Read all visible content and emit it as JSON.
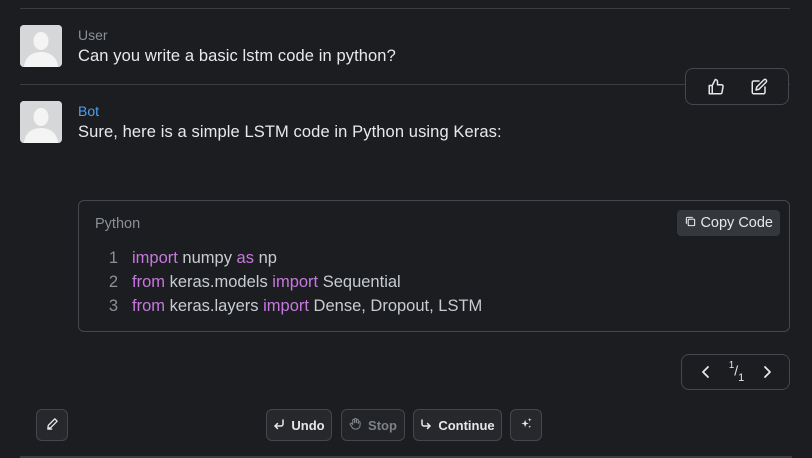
{
  "messages": [
    {
      "author": "User",
      "text": "Can you write a basic lstm code in python?"
    },
    {
      "author": "Bot",
      "text": "Sure, here is a simple LSTM code in Python using Keras:"
    }
  ],
  "code_block": {
    "language": "Python",
    "copy_label": "Copy Code",
    "lines": [
      {
        "num": "1",
        "tokens": [
          [
            "kw",
            "import"
          ],
          [
            "tx",
            " numpy "
          ],
          [
            "kw",
            "as"
          ],
          [
            "tx",
            " np"
          ]
        ]
      },
      {
        "num": "2",
        "tokens": [
          [
            "kw",
            "from"
          ],
          [
            "tx",
            " keras.models "
          ],
          [
            "kw",
            "import"
          ],
          [
            "tx",
            " Sequential"
          ]
        ]
      },
      {
        "num": "3",
        "tokens": [
          [
            "kw",
            "from"
          ],
          [
            "tx",
            " keras.layers "
          ],
          [
            "kw",
            "import"
          ],
          [
            "tx",
            " Dense, Dropout, LSTM"
          ]
        ]
      }
    ]
  },
  "pager": {
    "current": "1",
    "total": "1"
  },
  "toolbar": {
    "undo_label": "Undo",
    "stop_label": "Stop",
    "continue_label": "Continue"
  },
  "colors": {
    "background": "#1b1d20",
    "keyword": "#c678dd",
    "bot_author": "#4ea0f5",
    "user_author": "#8b9098"
  },
  "icons": {
    "msg_actions": [
      "thumbs-up-icon",
      "edit-icon"
    ],
    "copy": "copy-icon",
    "pager": [
      "chevron-left-icon",
      "chevron-right-icon"
    ],
    "toolbar": [
      "pencil-icon",
      "undo-arrow-icon",
      "hand-icon",
      "continue-arrow-icon",
      "sparkle-icon"
    ]
  }
}
